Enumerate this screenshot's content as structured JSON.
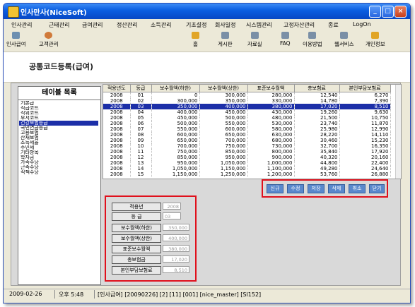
{
  "window": {
    "title": "인사만사(NiceSoft)"
  },
  "menu": [
    "인사관리",
    "근태관리",
    "급여관리",
    "정산관리",
    "소득관리",
    "기초설정",
    "회사일정",
    "시스템관리",
    "고정자산관리",
    "종료",
    "LogOn"
  ],
  "toolbar": {
    "left": [
      {
        "label": "인사급여",
        "icon": "calculator-icon"
      },
      {
        "label": "고객관리",
        "icon": "person-icon"
      }
    ],
    "right": [
      {
        "label": "홈",
        "icon": "home-icon"
      },
      {
        "label": "게시판",
        "icon": "board-icon"
      },
      {
        "label": "자료실",
        "icon": "folder-icon"
      },
      {
        "label": "FAQ",
        "icon": "faq-icon"
      },
      {
        "label": "이용방법",
        "icon": "help-icon"
      },
      {
        "label": "웹서비스",
        "icon": "web-icon"
      },
      {
        "label": "개인정보",
        "icon": "personal-info-icon"
      }
    ]
  },
  "page_title": "공통코드등록(급여)",
  "table_list": {
    "title": "테이블 목록",
    "items": [
      "기본급",
      "직급코드",
      "직위코드",
      "부서코드",
      "건강보험등급",
      "국민연금등급",
      "고용보험",
      "산재보험",
      "소득세율",
      "주민세",
      "기타항목",
      "학자금",
      "가족수당",
      "근속수당",
      "직책수당"
    ],
    "selected_index": 4
  },
  "grid": {
    "columns": [
      "적용년도",
      "등급",
      "보수월액(하한)",
      "보수월액(상한)",
      "표준보수월액",
      "총보험료",
      "본인부담보험료"
    ],
    "rows": [
      [
        "2008",
        "01",
        "0",
        "300,000",
        "280,000",
        "12,540",
        "6,270"
      ],
      [
        "2008",
        "02",
        "300,000",
        "350,000",
        "330,000",
        "14,780",
        "7,390"
      ],
      [
        "2008",
        "03",
        "350,000",
        "400,000",
        "380,000",
        "17,020",
        "8,510"
      ],
      [
        "2008",
        "04",
        "400,000",
        "450,000",
        "430,000",
        "19,260",
        "9,630"
      ],
      [
        "2008",
        "05",
        "450,000",
        "500,000",
        "480,000",
        "21,500",
        "10,750"
      ],
      [
        "2008",
        "06",
        "500,000",
        "550,000",
        "530,000",
        "23,740",
        "11,870"
      ],
      [
        "2008",
        "07",
        "550,000",
        "600,000",
        "580,000",
        "25,980",
        "12,990"
      ],
      [
        "2008",
        "08",
        "600,000",
        "650,000",
        "630,000",
        "28,220",
        "14,110"
      ],
      [
        "2008",
        "09",
        "650,000",
        "700,000",
        "680,000",
        "30,460",
        "15,230"
      ],
      [
        "2008",
        "10",
        "700,000",
        "750,000",
        "730,000",
        "32,700",
        "16,350"
      ],
      [
        "2008",
        "11",
        "750,000",
        "850,000",
        "800,000",
        "35,840",
        "17,920"
      ],
      [
        "2008",
        "12",
        "850,000",
        "950,000",
        "900,000",
        "40,320",
        "20,160"
      ],
      [
        "2008",
        "13",
        "950,000",
        "1,050,000",
        "1,000,000",
        "44,800",
        "22,400"
      ],
      [
        "2008",
        "14",
        "1,050,000",
        "1,150,000",
        "1,100,000",
        "49,280",
        "24,640"
      ],
      [
        "2008",
        "15",
        "1,150,000",
        "1,250,000",
        "1,200,000",
        "53,760",
        "26,880"
      ]
    ],
    "selected_row": 2
  },
  "buttons": [
    "신규",
    "수정",
    "저장",
    "삭제",
    "취소",
    "닫기"
  ],
  "form": [
    {
      "label": "적용년",
      "value": "2008"
    },
    {
      "label": "등   급",
      "value": "03"
    },
    {
      "label": "보수월액(하한)",
      "value": "350,000"
    },
    {
      "label": "보수월액(상한)",
      "value": "400,000"
    },
    {
      "label": "표준보수월액",
      "value": "380,000"
    },
    {
      "label": "총보험금",
      "value": "17,020"
    },
    {
      "label": "본인부담보험료",
      "value": "8,510"
    }
  ],
  "status": {
    "date": "2009-02-26",
    "time": "오후 5:48",
    "info": "[인사급여] [20090226] [2] [11] [001] [nice_master] [SI152]"
  },
  "colors": {
    "title_bar": "#0a5de0",
    "selection": "#1c2fa8",
    "button": "#5a88cc",
    "highlight_border": "#e0101c"
  }
}
